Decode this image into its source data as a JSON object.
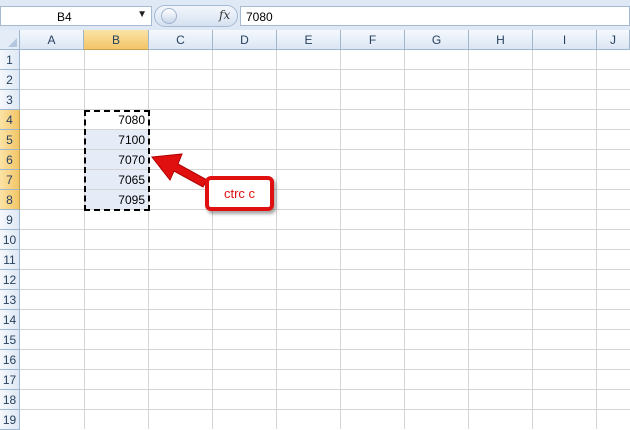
{
  "formula_bar": {
    "name_box": "B4",
    "fx_symbol": "fx",
    "formula_value": "7080"
  },
  "columns": [
    "A",
    "B",
    "C",
    "D",
    "E",
    "F",
    "G",
    "H",
    "I",
    "J"
  ],
  "rows": [
    "1",
    "2",
    "3",
    "4",
    "5",
    "6",
    "7",
    "8",
    "9",
    "10",
    "11",
    "12",
    "13",
    "14",
    "15",
    "16",
    "17",
    "18",
    "19"
  ],
  "cells": [
    {
      "ref": "B4",
      "value": "7080"
    },
    {
      "ref": "B5",
      "value": "7100"
    },
    {
      "ref": "B6",
      "value": "7070"
    },
    {
      "ref": "B7",
      "value": "7065"
    },
    {
      "ref": "B8",
      "value": "7095"
    }
  ],
  "callout": {
    "text": "ctrc c"
  },
  "colors": {
    "callout_red": "#e01010",
    "selection_header": "#f3c568",
    "header_bg": "#dfe8f5"
  }
}
